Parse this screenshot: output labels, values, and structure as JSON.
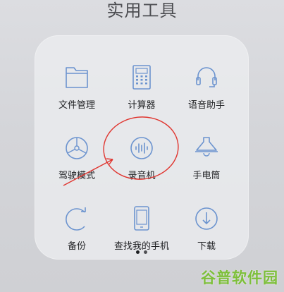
{
  "folder": {
    "title": "实用工具",
    "pages": 2,
    "active_page": 1
  },
  "apps": [
    {
      "label": "文件管理",
      "icon": "folder-icon"
    },
    {
      "label": "计算器",
      "icon": "calculator-icon"
    },
    {
      "label": "语音助手",
      "icon": "headset-icon"
    },
    {
      "label": "驾驶模式",
      "icon": "steering-wheel-icon"
    },
    {
      "label": "录音机",
      "icon": "sound-wave-icon"
    },
    {
      "label": "手电筒",
      "icon": "flashlight-icon"
    },
    {
      "label": "备份",
      "icon": "backup-refresh-icon"
    },
    {
      "label": "查找我的手机",
      "icon": "find-phone-icon"
    },
    {
      "label": "下载",
      "icon": "download-icon"
    }
  ],
  "colors": {
    "icon_stroke": "#6b93cf",
    "annotation": "#e0352f",
    "watermark": "#7dbf3a"
  },
  "highlighted_app": "录音机",
  "watermark": "谷普软件园"
}
